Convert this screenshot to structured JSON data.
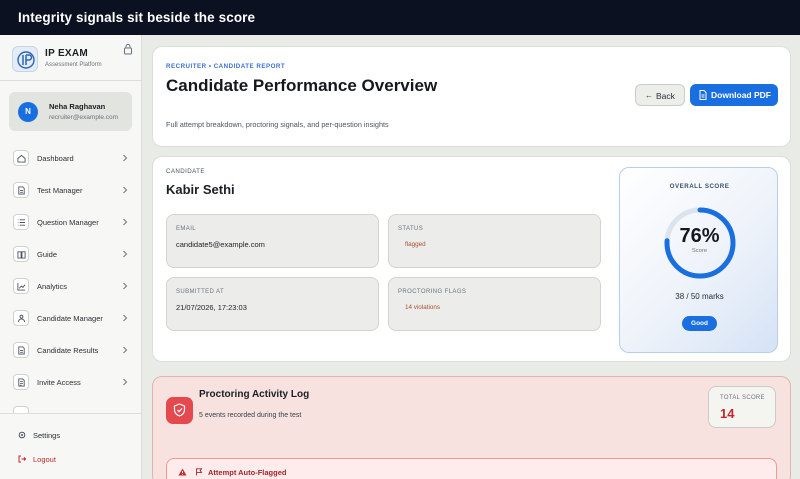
{
  "banner": {
    "text": "Integrity signals sit beside the score"
  },
  "sidebar": {
    "brand_name": "IP EXAM",
    "brand_sub": "Assessment Platform",
    "user": {
      "initial": "N",
      "name": "Neha Raghavan",
      "email": "recruiter@example.com"
    },
    "items": [
      {
        "label": "Dashboard",
        "icon": "home-icon"
      },
      {
        "label": "Test Manager",
        "icon": "document-icon"
      },
      {
        "label": "Question Manager",
        "icon": "list-icon"
      },
      {
        "label": "Guide",
        "icon": "book-icon"
      },
      {
        "label": "Analytics",
        "icon": "chart-icon"
      },
      {
        "label": "Candidate Manager",
        "icon": "users-icon"
      },
      {
        "label": "Candidate Results",
        "icon": "document-icon"
      },
      {
        "label": "Invite Access",
        "icon": "invite-icon"
      }
    ],
    "settings_label": "Settings",
    "logout_label": "Logout"
  },
  "header": {
    "breadcrumb": "RECRUITER • CANDIDATE REPORT",
    "title": "Candidate Performance Overview",
    "description": "Full attempt breakdown, proctoring signals, and per-question insights",
    "back_label": "Back",
    "pdf_label": "Download PDF"
  },
  "candidate": {
    "section_label": "CANDIDATE",
    "name": "Kabir Sethi",
    "email_label": "EMAIL",
    "email": "candidate5@example.com",
    "status_label": "STATUS",
    "status": "flagged",
    "submitted_label": "SUBMITTED AT",
    "submitted": "21/07/2026, 17:23:03",
    "flags_label": "PROCTORING FLAGS",
    "flags": "14 violations"
  },
  "score": {
    "label": "OVERALL SCORE",
    "percent_text": "76%",
    "percent": 76,
    "sub": "Score",
    "marks": "38 / 50 marks",
    "badge": "Good",
    "accent": "#1a6fe0"
  },
  "log": {
    "title": "Proctoring Activity Log",
    "subtitle": "5 events recorded during the test",
    "total_label": "TOTAL SCORE",
    "total_value": "14",
    "flag_title": "Attempt Auto-Flagged",
    "danger_color": "#e5484d"
  }
}
